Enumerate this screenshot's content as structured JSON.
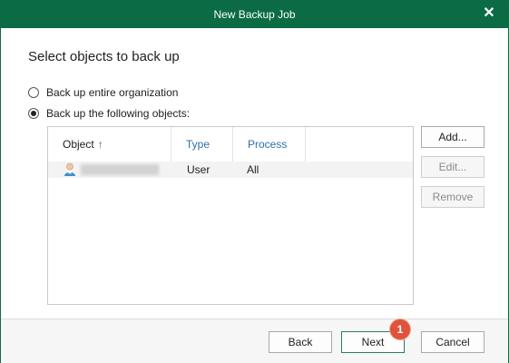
{
  "window": {
    "title": "New Backup Job",
    "close_symbol": "✕"
  },
  "page": {
    "heading": "Select objects to back up"
  },
  "options": {
    "entire_org": {
      "label": "Back up entire organization",
      "selected": false
    },
    "following": {
      "label": "Back up the following objects:",
      "selected": true
    }
  },
  "table": {
    "columns": {
      "object": "Object",
      "object_sort": "↑",
      "type": "Type",
      "process": "Process"
    },
    "rows": [
      {
        "object": "",
        "type": "User",
        "process": "All"
      }
    ]
  },
  "side_buttons": {
    "add": "Add...",
    "edit": "Edit...",
    "remove": "Remove"
  },
  "footer": {
    "back": "Back",
    "next": "Next",
    "cancel": "Cancel",
    "step_badge": "1"
  },
  "colors": {
    "titlebar": "#0b6b45",
    "link_blue": "#2f6fa8",
    "badge": "#e0523a"
  }
}
